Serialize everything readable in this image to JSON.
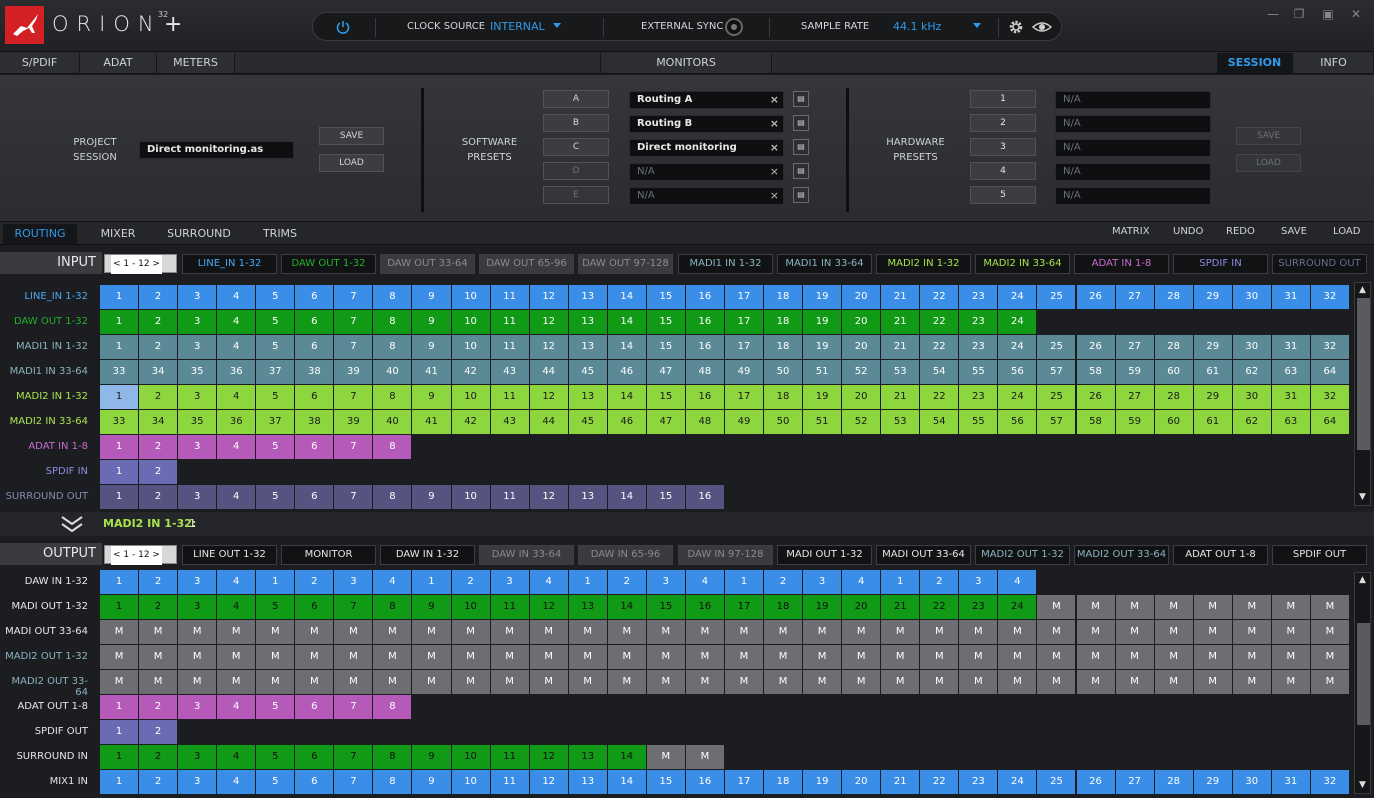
{
  "app": {
    "brand": "ORION",
    "brand_sup": "32",
    "brand_plus": "+"
  },
  "controls": {
    "clock_source_label": "CLOCK SOURCE",
    "clock_source_value": "INTERNAL",
    "external_sync_label": "EXTERNAL SYNC",
    "sample_rate_label": "SAMPLE RATE",
    "sample_rate_value": "44.1 kHz"
  },
  "top_tabs": [
    "S/PDIF",
    "ADAT",
    "METERS",
    "MONITORS",
    "SESSION",
    "INFO"
  ],
  "session": {
    "project_label": "PROJECT\nSESSION",
    "project_value": "Direct monitoring.as",
    "save": "SAVE",
    "load": "LOAD",
    "software_label": "SOFTWARE\nPRESETS",
    "software_slots": [
      "A",
      "B",
      "C",
      "D",
      "E"
    ],
    "software_values": [
      "Routing A",
      "Routing B",
      "Direct monitoring",
      "N/A",
      "N/A"
    ],
    "hardware_label": "HARDWARE\nPRESETS",
    "hardware_slots": [
      "1",
      "2",
      "3",
      "4",
      "5"
    ],
    "hardware_values": [
      "N/A",
      "N/A",
      "N/A",
      "N/A",
      "N/A"
    ]
  },
  "sub_tabs": [
    "ROUTING",
    "MIXER",
    "SURROUND",
    "TRIMS"
  ],
  "right_actions": [
    "MATRIX",
    "UNDO",
    "REDO",
    "SAVE",
    "LOAD"
  ],
  "input": {
    "title": "INPUT",
    "pager": "< 1 - 12 >",
    "tabs": [
      "LINE_IN 1-32",
      "DAW OUT 1-32",
      "DAW OUT 33-64",
      "DAW OUT 65-96",
      "DAW OUT 97-128",
      "MADI1 IN 1-32",
      "MADI1 IN 33-64",
      "MADI2 IN 1-32",
      "MADI2 IN 33-64",
      "ADAT IN 1-8",
      "SPDIF IN",
      "SURROUND OUT"
    ],
    "rows": [
      {
        "label": "LINE_IN 1-32",
        "start": 1,
        "count": 32,
        "color": "#3a8ee8",
        "label_color": "#4aa8f0"
      },
      {
        "label": "DAW OUT 1-32",
        "start": 1,
        "count": 24,
        "color": "#109a16",
        "label_color": "#23b02a"
      },
      {
        "label": "MADI1 IN 1-32",
        "start": 1,
        "count": 32,
        "color": "#5b8a96",
        "label_color": "#8ab4bf"
      },
      {
        "label": "MADI1 IN 33-64",
        "start": 33,
        "count": 32,
        "color": "#5b8a96",
        "label_color": "#8ab4bf"
      },
      {
        "label": "MADI2 IN 1-32",
        "start": 1,
        "count": 32,
        "color": "#8ed63e",
        "label_color": "#a8e24d",
        "first_color": "#8fb7e8"
      },
      {
        "label": "MADI2 IN 33-64",
        "start": 33,
        "count": 32,
        "color": "#8ed63e",
        "label_color": "#a8e24d"
      },
      {
        "label": "ADAT IN 1-8",
        "start": 1,
        "count": 8,
        "color": "#b55ab8",
        "label_color": "#c86ccd"
      },
      {
        "label": "SPDIF IN",
        "start": 1,
        "count": 2,
        "color": "#6b6bb5",
        "label_color": "#8c8ce0"
      },
      {
        "label": "SURROUND OUT",
        "start": 1,
        "count": 16,
        "color": "#55537f",
        "label_color": "#8a89b0"
      }
    ]
  },
  "status": {
    "label": "MADI2 IN 1-32:",
    "value": " 1"
  },
  "output": {
    "title": "OUTPUT",
    "pager": "< 1 - 12 >",
    "tabs": [
      "LINE OUT 1-32",
      "MONITOR",
      "DAW IN 1-32",
      "DAW IN 33-64",
      "DAW IN 65-96",
      "DAW IN 97-128",
      "MADI OUT 1-32",
      "MADI OUT 33-64",
      "MADI2 OUT 1-32",
      "MADI2 OUT 33-64",
      "ADAT OUT 1-8",
      "SPDIF OUT"
    ],
    "rows": [
      {
        "label": "DAW IN 1-32",
        "values": [
          "1",
          "2",
          "3",
          "4",
          "1",
          "2",
          "3",
          "4",
          "1",
          "2",
          "3",
          "4",
          "1",
          "2",
          "3",
          "4",
          "1",
          "2",
          "3",
          "4",
          "1",
          "2",
          "3",
          "4"
        ],
        "colors": [
          "#3a8ee8"
        ]
      },
      {
        "label": "MADI OUT 1-32",
        "values": [
          "1",
          "2",
          "3",
          "4",
          "5",
          "6",
          "7",
          "8",
          "9",
          "10",
          "11",
          "12",
          "13",
          "14",
          "15",
          "16",
          "17",
          "18",
          "19",
          "20",
          "21",
          "22",
          "23",
          "24",
          "M",
          "M",
          "M",
          "M",
          "M",
          "M",
          "M",
          "M"
        ],
        "colors": [
          "#109a16"
        ]
      },
      {
        "label": "MADI OUT 33-64",
        "values": [
          "M",
          "M",
          "M",
          "M",
          "M",
          "M",
          "M",
          "M",
          "M",
          "M",
          "M",
          "M",
          "M",
          "M",
          "M",
          "M",
          "M",
          "M",
          "M",
          "M",
          "M",
          "M",
          "M",
          "M",
          "M",
          "M",
          "M",
          "M",
          "M",
          "M",
          "M",
          "M"
        ],
        "colors": [
          "#6d6e72"
        ]
      },
      {
        "label": "MADI2 OUT 1-32",
        "values": [
          "M",
          "M",
          "M",
          "M",
          "M",
          "M",
          "M",
          "M",
          "M",
          "M",
          "M",
          "M",
          "M",
          "M",
          "M",
          "M",
          "M",
          "M",
          "M",
          "M",
          "M",
          "M",
          "M",
          "M",
          "M",
          "M",
          "M",
          "M",
          "M",
          "M",
          "M",
          "M"
        ],
        "colors": [
          "#6d6e72"
        ]
      },
      {
        "label": "MADI2 OUT 33-64",
        "values": [
          "M",
          "M",
          "M",
          "M",
          "M",
          "M",
          "M",
          "M",
          "M",
          "M",
          "M",
          "M",
          "M",
          "M",
          "M",
          "M",
          "M",
          "M",
          "M",
          "M",
          "M",
          "M",
          "M",
          "M",
          "M",
          "M",
          "M",
          "M",
          "M",
          "M",
          "M",
          "M"
        ],
        "colors": [
          "#6d6e72"
        ]
      },
      {
        "label": "ADAT OUT 1-8",
        "values": [
          "1",
          "2",
          "3",
          "4",
          "5",
          "6",
          "7",
          "8"
        ],
        "colors": [
          "#b55ab8"
        ]
      },
      {
        "label": "SPDIF OUT",
        "values": [
          "1",
          "2"
        ],
        "colors": [
          "#6b6bb5"
        ]
      },
      {
        "label": "SURROUND IN",
        "values": [
          "1",
          "2",
          "3",
          "4",
          "5",
          "6",
          "7",
          "8",
          "9",
          "10",
          "11",
          "12",
          "13",
          "14",
          "M",
          "M"
        ],
        "colors": [
          "#109a16"
        ]
      },
      {
        "label": "MIX1 IN",
        "values": [
          "1",
          "2",
          "3",
          "4",
          "5",
          "6",
          "7",
          "8",
          "9",
          "10",
          "11",
          "12",
          "13",
          "14",
          "15",
          "16",
          "17",
          "18",
          "19",
          "20",
          "21",
          "22",
          "23",
          "24",
          "25",
          "26",
          "27",
          "28",
          "29",
          "30",
          "31",
          "32"
        ],
        "colors": [
          "#3a8ee8"
        ]
      }
    ]
  },
  "colors": {
    "accent": "#2f9bea",
    "mute": "#6d6e72"
  }
}
